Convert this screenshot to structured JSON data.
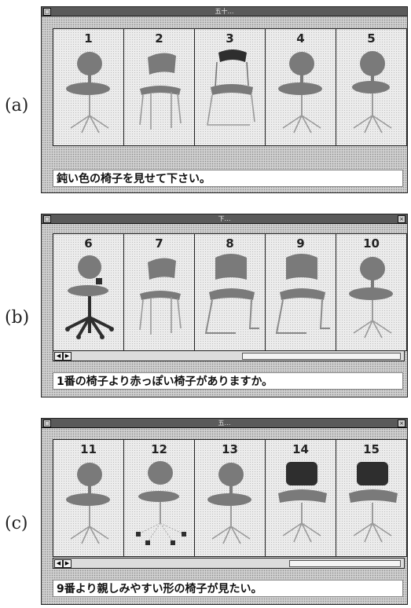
{
  "panels": [
    {
      "label": "(a)",
      "title": "五十…",
      "caption": "鈍い色の椅子を見せて下さい。",
      "items": [
        {
          "number": "1",
          "chair": "swivel-chair"
        },
        {
          "number": "2",
          "chair": "stacking-chair"
        },
        {
          "number": "3",
          "chair": "cantilever-chair"
        },
        {
          "number": "4",
          "chair": "swivel-chair"
        },
        {
          "number": "5",
          "chair": "round-back-swivel-chair"
        }
      ]
    },
    {
      "label": "(b)",
      "title": "下…",
      "caption": "1番の椅子より赤っぽい椅子がありますか。",
      "items": [
        {
          "number": "6",
          "chair": "swivel-chair-with-arms"
        },
        {
          "number": "7",
          "chair": "stacking-chair"
        },
        {
          "number": "8",
          "chair": "sled-base-chair"
        },
        {
          "number": "9",
          "chair": "sled-base-chair"
        },
        {
          "number": "10",
          "chair": "swivel-chair"
        }
      ]
    },
    {
      "label": "(c)",
      "title": "五…",
      "caption": "9番より親しみやすい形の椅子が見たい。",
      "items": [
        {
          "number": "11",
          "chair": "swivel-chair"
        },
        {
          "number": "12",
          "chair": "swivel-chair-casters"
        },
        {
          "number": "13",
          "chair": "swivel-chair"
        },
        {
          "number": "14",
          "chair": "padded-swivel-chair"
        },
        {
          "number": "15",
          "chair": "padded-swivel-chair"
        }
      ]
    }
  ],
  "colors": {
    "chair": "#7a7a7a",
    "chair_dark": "#2e2e2e",
    "frame": "#222222"
  }
}
